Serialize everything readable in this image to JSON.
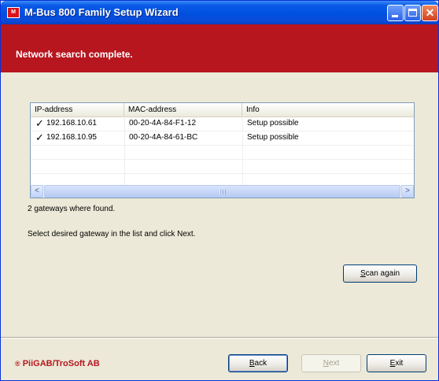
{
  "window": {
    "title": "M-Bus 800 Family Setup Wizard",
    "icon_text": "M",
    "controls": {
      "minimize": "minimize-icon",
      "maximize": "maximize-icon",
      "close": "✕"
    }
  },
  "banner": {
    "heading": "Network search complete."
  },
  "list": {
    "columns": [
      "IP-address",
      "MAC-address",
      "Info"
    ],
    "rows": [
      {
        "checked": "✓",
        "ip": "192.168.10.61",
        "mac": "00-20-4A-84-F1-12",
        "info": "Setup possible"
      },
      {
        "checked": "✓",
        "ip": "192.168.10.95",
        "mac": "00-20-4A-84-61-BC",
        "info": "Setup possible"
      }
    ],
    "scroll_left": "<",
    "scroll_right": ">"
  },
  "status": {
    "found_text": "2 gateways where found."
  },
  "instruction": {
    "text": "Select desired gateway in the list and click Next."
  },
  "buttons": {
    "scan_again_prefix": "S",
    "scan_again_rest": "can again",
    "back_prefix": "B",
    "back_rest": "ack",
    "next_prefix": "N",
    "next_rest": "ext",
    "exit_prefix": "E",
    "exit_rest": "xit"
  },
  "footer": {
    "brand_mark": "®",
    "brand_text": "PiiGAB/TroSoft AB"
  },
  "colors": {
    "banner": "#b7161f",
    "titlebar": "#0050e0",
    "brand": "#b7161f"
  }
}
